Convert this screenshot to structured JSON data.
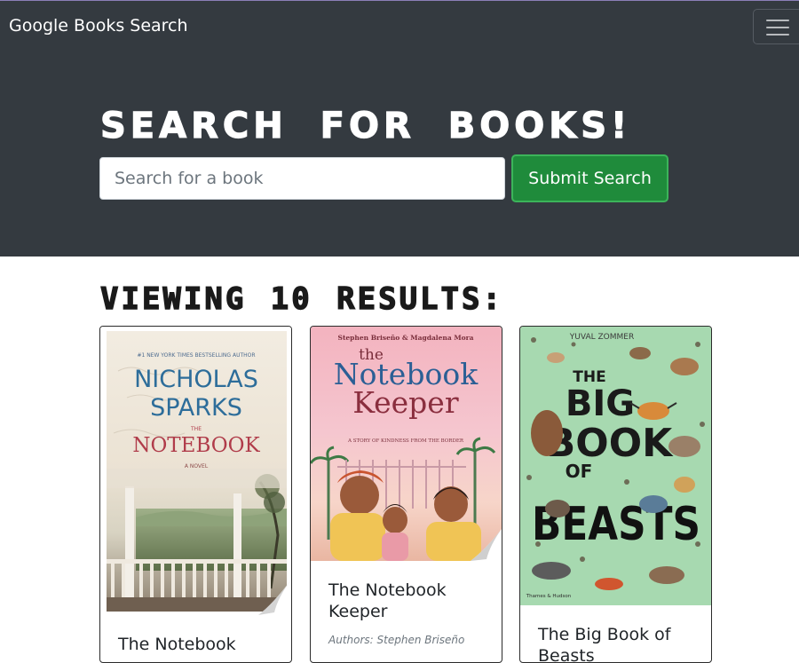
{
  "navbar": {
    "brand": "Google Books Search",
    "menu_icon": "hamburger-menu-icon"
  },
  "hero": {
    "title": "Search for Books!",
    "search_placeholder": "Search for a book",
    "search_value": "",
    "submit_label": "Submit Search"
  },
  "results": {
    "heading": "Viewing 10 results:",
    "books": [
      {
        "title": "The Notebook",
        "cover": {
          "top_line": "#1 NEW YORK TIMES BESTSELLING AUTHOR",
          "author_line1": "NICHOLAS",
          "author_line2": "SPARKS",
          "the": "THE",
          "title": "NOTEBOOK",
          "subtitle": "A NOVEL"
        }
      },
      {
        "title": "The Notebook Keeper",
        "authors": "Authors: Stephen Briseño",
        "cover": {
          "authors": "Stephen Briseño & Magdalena Mora",
          "the": "the",
          "title_line1": "Notebook",
          "title_line2": "Keeper",
          "tagline": "A STORY OF KINDNESS FROM THE BORDER"
        }
      },
      {
        "title": "The Big Book of Beasts",
        "cover": {
          "author": "YUVAL ZOMMER",
          "the": "THE",
          "big": "BIG",
          "book": "BOOK",
          "of": "OF",
          "beasts": "BEASTS",
          "publisher": "Thames & Hudson"
        }
      }
    ]
  }
}
